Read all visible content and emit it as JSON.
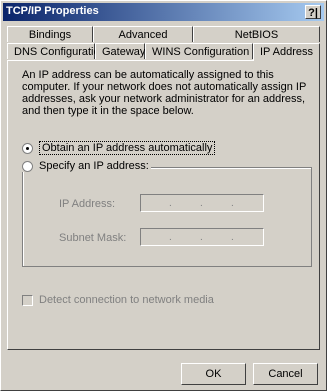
{
  "window": {
    "title": "TCP/IP Properties",
    "help_label": "?|"
  },
  "tabs_row1": [
    "Bindings",
    "Advanced",
    "NetBIOS"
  ],
  "tabs_row2": [
    "DNS Configuration",
    "Gateway",
    "WINS Configuration",
    "IP Address"
  ],
  "active_tab": "IP Address",
  "description": "An IP address can be automatically assigned to this computer. If your network does not automatically assign IP addresses, ask your network administrator for an address, and then type it in the space below.",
  "options": {
    "obtain_auto": "Obtain an IP address automatically",
    "specify": "Specify an IP address:"
  },
  "fields": {
    "ip_label": "IP Address:",
    "mask_label": "Subnet Mask:"
  },
  "detect_label": "Detect connection to network media",
  "buttons": {
    "ok": "OK",
    "cancel": "Cancel"
  }
}
